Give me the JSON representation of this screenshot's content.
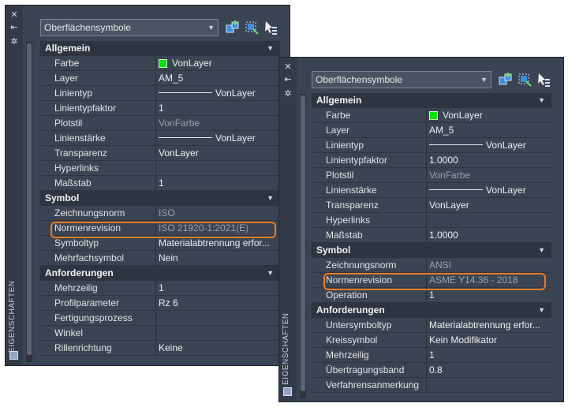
{
  "panel_left": {
    "vertical_label": "EIGENSCHAFTEN",
    "dropdown": "Oberflächensymbole",
    "sections": [
      {
        "title": "Allgemein",
        "rows": [
          {
            "name": "Farbe",
            "value": "VonLayer",
            "kind": "swatch"
          },
          {
            "name": "Layer",
            "value": "AM_5"
          },
          {
            "name": "Linientyp",
            "value": "VonLayer",
            "kind": "line"
          },
          {
            "name": "Linientypfaktor",
            "value": "1"
          },
          {
            "name": "Plotstil",
            "value": "VonFarbe",
            "dim": true
          },
          {
            "name": "Linienstärke",
            "value": "VonLayer",
            "kind": "line"
          },
          {
            "name": "Transparenz",
            "value": "VonLayer"
          },
          {
            "name": "Hyperlinks",
            "value": ""
          },
          {
            "name": "Maßstab",
            "value": "1"
          }
        ]
      },
      {
        "title": "Symbol",
        "rows": [
          {
            "name": "Zeichnungsnorm",
            "value": "ISO",
            "dim": true
          },
          {
            "name": "Normenrevision",
            "value": "ISO 21920-1:2021(E)",
            "dim": true,
            "highlight": true
          },
          {
            "name": "Symboltyp",
            "value": "Materialabtrennung  erfor..."
          },
          {
            "name": "Mehrfachsymbol",
            "value": "Nein"
          }
        ]
      },
      {
        "title": "Anforderungen",
        "rows": [
          {
            "name": "Mehrzeilig",
            "value": "1"
          },
          {
            "name": "Profilparameter",
            "value": "Rz 6"
          },
          {
            "name": "Fertigungsprozess",
            "value": ""
          },
          {
            "name": "Winkel",
            "value": ""
          },
          {
            "name": "Rillenrichtung",
            "value": "Keine"
          }
        ]
      }
    ]
  },
  "panel_right": {
    "vertical_label": "EIGENSCHAFTEN",
    "dropdown": "Oberflächensymbole",
    "sections": [
      {
        "title": "Allgemein",
        "rows": [
          {
            "name": "Farbe",
            "value": "VonLayer",
            "kind": "swatch"
          },
          {
            "name": "Layer",
            "value": "AM_5"
          },
          {
            "name": "Linientyp",
            "value": "VonLayer",
            "kind": "line"
          },
          {
            "name": "Linientypfaktor",
            "value": "1.0000"
          },
          {
            "name": "Plotstil",
            "value": "VonFarbe",
            "dim": true
          },
          {
            "name": "Linienstärke",
            "value": "VonLayer",
            "kind": "line"
          },
          {
            "name": "Transparenz",
            "value": "VonLayer"
          },
          {
            "name": "Hyperlinks",
            "value": ""
          },
          {
            "name": "Maßstab",
            "value": "1.0000"
          }
        ]
      },
      {
        "title": "Symbol",
        "rows": [
          {
            "name": "Zeichnungsnorm",
            "value": "ANSI",
            "dim": true
          },
          {
            "name": "Normenrevision",
            "value": "ASME Y14.36 - 2018",
            "dim": true,
            "highlight": true
          },
          {
            "name": "Operation",
            "value": "1"
          }
        ]
      },
      {
        "title": "Anforderungen",
        "rows": [
          {
            "name": "Untersymboltyp",
            "value": "Materialabtrennung  erfor..."
          },
          {
            "name": "Kreissymbol",
            "value": "Kein Modifikator"
          },
          {
            "name": "Mehrzeilig",
            "value": "1"
          },
          {
            "name": "Übertragungsband",
            "value": "0.8"
          },
          {
            "name": "Verfahrensanmerkung",
            "value": ""
          }
        ]
      }
    ]
  },
  "colors": {
    "highlight": "#ee7b22",
    "swatch": "#00e600",
    "panel_bg": "#3b4453"
  },
  "icons": [
    "close-icon",
    "pin-icon",
    "settings-icon",
    "quick-select-icon",
    "select-objects-icon",
    "toggle-pickadd-icon",
    "chevron-down-icon"
  ]
}
